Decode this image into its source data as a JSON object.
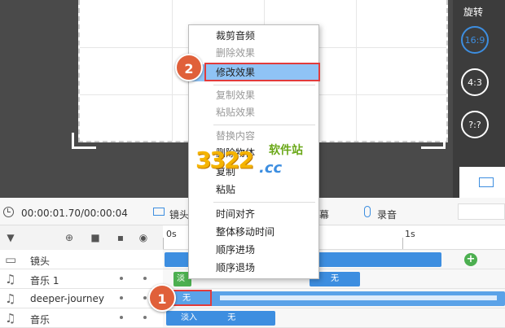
{
  "preview": {
    "rotate_label": "旋转",
    "ratios": [
      "16:9",
      "4:3",
      "?:?"
    ]
  },
  "toolbar": {
    "timecode": "00:00:01.70/00:00:04",
    "lens_label": "镜头",
    "screen_label": "幕",
    "record_label": "录音"
  },
  "timeline": {
    "ruler_start": "0s",
    "ruler_mark": "1s",
    "tracks": [
      {
        "name": "镜头",
        "icon": "camera-icon"
      },
      {
        "name": "音乐 1",
        "icon": "music-icon"
      },
      {
        "name": "deeper-journey",
        "icon": "music-icon"
      },
      {
        "name": "音乐",
        "icon": "music-icon"
      }
    ],
    "clip_fadein": "淡入",
    "clip_none": "无"
  },
  "context_menu": {
    "items": [
      {
        "label": "裁剪音频",
        "disabled": false
      },
      {
        "label": "删除效果",
        "disabled": true
      },
      {
        "label": "修改效果",
        "disabled": false,
        "selected": true
      },
      {
        "label": "复制效果",
        "disabled": true
      },
      {
        "label": "粘贴效果",
        "disabled": true
      },
      {
        "label": "替换内容",
        "disabled": true
      },
      {
        "label": "删除物体",
        "disabled": false
      },
      {
        "label": "复制",
        "disabled": false
      },
      {
        "label": "粘贴",
        "disabled": false
      },
      {
        "label": "时间对齐",
        "disabled": false
      },
      {
        "label": "整体移动时间",
        "disabled": false
      },
      {
        "label": "顺序进场",
        "disabled": false
      },
      {
        "label": "顺序退场",
        "disabled": false
      }
    ]
  },
  "annotations": {
    "step1": "1",
    "step2": "2"
  },
  "watermark": {
    "number": "3322",
    "site": "软件站",
    "domain": ".cc"
  },
  "colors": {
    "accent": "#3d8ee0",
    "selection": "#8fc3f5",
    "highlight": "#e23b3b",
    "badge": "#e0603a"
  }
}
